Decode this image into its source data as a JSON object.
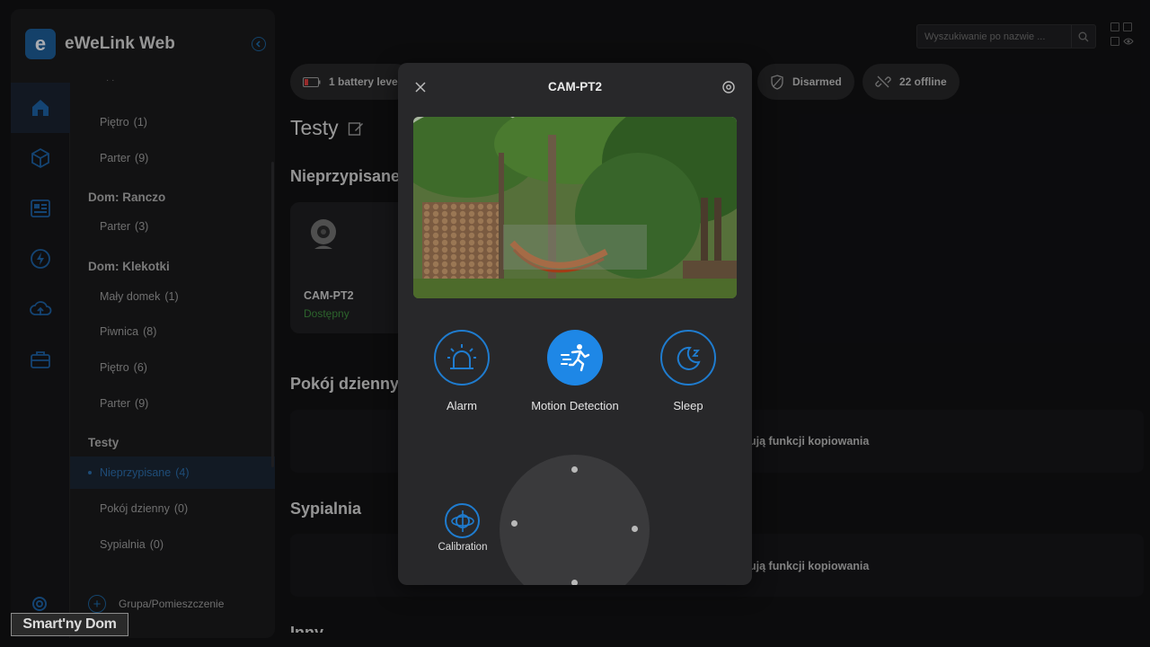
{
  "app": {
    "name": "eWeLink Web",
    "logo_letter": "e"
  },
  "rail": {
    "items": [
      "home-icon",
      "cube-icon",
      "scene-icon",
      "bolt-icon",
      "cloud-upload-icon",
      "toolbox-icon"
    ],
    "active": "home-icon"
  },
  "tree": {
    "rows": [
      {
        "type": "child",
        "label": "Piętro",
        "count": "(1)"
      },
      {
        "type": "child",
        "label": "Parter",
        "count": "(9)"
      },
      {
        "type": "group",
        "label": "Dom: Ranczo"
      },
      {
        "type": "child",
        "label": "Parter",
        "count": "(3)"
      },
      {
        "type": "group",
        "label": "Dom: Klekotki"
      },
      {
        "type": "child",
        "label": "Mały domek",
        "count": "(1)"
      },
      {
        "type": "child",
        "label": "Piwnica",
        "count": "(8)"
      },
      {
        "type": "child",
        "label": "Piętro",
        "count": "(6)"
      },
      {
        "type": "child",
        "label": "Parter",
        "count": "(9)"
      },
      {
        "type": "group",
        "label": "Testy"
      },
      {
        "type": "child",
        "label": "Nieprzypisane",
        "count": "(4)",
        "selected": true
      },
      {
        "type": "child",
        "label": "Pokój dzienny",
        "count": "(0)"
      },
      {
        "type": "child",
        "label": "Sypialnia",
        "count": "(0)"
      }
    ],
    "add_group_label": "Grupa/Pomieszczenie"
  },
  "search": {
    "placeholder": "Wyszukiwanie po nazwie ..."
  },
  "chips": {
    "battery": "1 battery level",
    "disarmed": "Disarmed",
    "offline": "22 offline"
  },
  "main": {
    "title": "Testy",
    "sections": {
      "unassigned": "Nieprzypisane",
      "living_room": "Pokój dzienny",
      "bedroom": "Sypialnia",
      "other": "Inny"
    },
    "device": {
      "name": "CAM-PT2",
      "status": "Dostępny"
    },
    "copy_note_1": "ują funkcji kopiowania",
    "copy_note_2": "ują funkcji kopiowania"
  },
  "modal": {
    "title": "CAM-PT2",
    "modes": [
      {
        "id": "alarm",
        "label": "Alarm",
        "icon": "siren-icon",
        "active": false
      },
      {
        "id": "motion",
        "label": "Motion Detection",
        "icon": "running-person-icon",
        "active": true
      },
      {
        "id": "sleep",
        "label": "Sleep",
        "icon": "moon-icon",
        "active": false
      }
    ],
    "calibration_label": "Calibration"
  },
  "watermark": "Smart'ny Dom",
  "colors": {
    "accent": "#1e87e6",
    "available": "#3d8a3d",
    "selected_text": "#2a6aa6"
  }
}
